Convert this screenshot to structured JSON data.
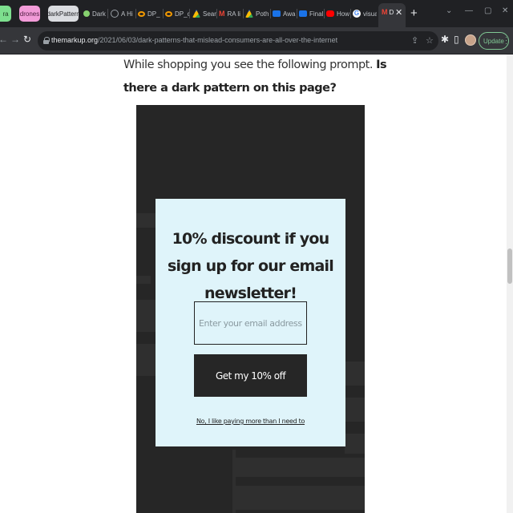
{
  "browser": {
    "tab_groups": [
      {
        "label": "ra",
        "color": "#7ddf8e"
      },
      {
        "label": "drones",
        "color": "#f29bd8"
      },
      {
        "label": "darkPattern",
        "color": "#dadce0"
      }
    ],
    "tabs": [
      {
        "label": "Dark",
        "icon": "leaf-icon",
        "color": "#86d16f"
      },
      {
        "label": "A Hi",
        "icon": "globe-icon",
        "color": "#9aa0a6"
      },
      {
        "label": "DP_",
        "icon": "infinity-icon",
        "color": "#f29900"
      },
      {
        "label": "DP_c",
        "icon": "infinity-icon",
        "color": "#f29900"
      },
      {
        "label": "Sear",
        "icon": "drive-icon",
        "color": "#4285f4"
      },
      {
        "label": "RA li",
        "icon": "gmail-icon",
        "color": "#ea4335"
      },
      {
        "label": "Poth",
        "icon": "drive-icon",
        "color": "#fbbc04"
      },
      {
        "label": "Awa",
        "icon": "letter-icon",
        "color": "#1a73e8"
      },
      {
        "label": "Final",
        "icon": "letter-icon",
        "color": "#1a73e8"
      },
      {
        "label": "How",
        "icon": "youtube-icon",
        "color": "#ff0000"
      },
      {
        "label": "visua",
        "icon": "google-icon",
        "color": "#ffffff"
      }
    ],
    "active_tab": {
      "label": "D",
      "icon": "gmail-icon",
      "color": "#ea4335"
    },
    "url_host": "themarkup.org",
    "url_path": "/2021/06/03/dark-patterns-that-mislead-consumers-are-all-over-the-internet",
    "update_label": "Update"
  },
  "page": {
    "prompt_text": "While shopping you see the following prompt. ",
    "prompt_question": "Is there a dark pattern on this page?",
    "popup": {
      "title": "10% discount if you sign up for our email newsletter!",
      "email_placeholder": "Enter your email address",
      "cta_label": "Get my 10% off",
      "decline_label": "No, I like paying more than I need to"
    }
  },
  "colors": {
    "popup_background": "#dff4fa",
    "mock_background": "#262626",
    "accent_update": "#81c995"
  }
}
